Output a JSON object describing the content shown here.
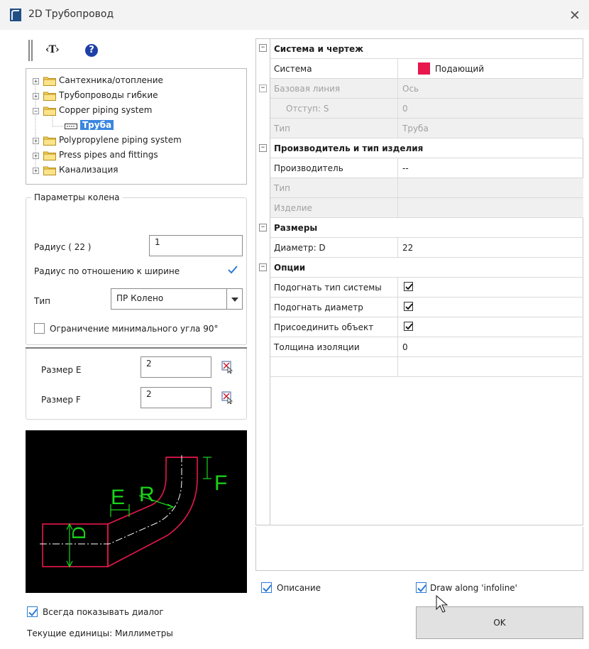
{
  "window": {
    "title": "2D Трубопровод",
    "close_label": "✕"
  },
  "toolbar": {
    "text_tool_label": "‹T›",
    "help_label": "?"
  },
  "tree": {
    "items": [
      {
        "label": "Сантехника/отопление",
        "expanded": false
      },
      {
        "label": "Трубопроводы гибкие",
        "expanded": false
      },
      {
        "label": "Copper piping system",
        "expanded": true
      },
      {
        "label": "Труба",
        "selected": true
      },
      {
        "label": "Polypropylene piping system",
        "expanded": false
      },
      {
        "label": "Press pipes and fittings",
        "expanded": false
      },
      {
        "label": "Канализация",
        "expanded": false
      }
    ]
  },
  "elbow_params": {
    "group_title": "Параметры колена",
    "radius_label": "Радиус ( 22 )",
    "radius_value": "1",
    "radius_relative_label": "Радиус по отношению к ширине",
    "radius_relative_checked": true,
    "type_label": "Тип",
    "type_value": "ПР Колено",
    "min_angle_label": "Ограничение минимального угла 90°",
    "min_angle_checked": false,
    "size_e_label": "Размер E",
    "size_e_value": "2",
    "size_f_label": "Размер F",
    "size_f_value": "2"
  },
  "preview": {
    "label_e": "E",
    "label_r": "R",
    "label_f": "F",
    "label_d": "D"
  },
  "always_show": {
    "label": "Всегда показывать диалог",
    "checked": true
  },
  "units": {
    "label": "Текущие единицы: Миллиметры"
  },
  "properties": {
    "cat_system": "Система и чертеж",
    "system_label": "Система",
    "system_value": "Подающий",
    "system_color": "#e8174c",
    "baseline_label": "Базовая линия",
    "baseline_value": "Ось",
    "offset_label": "Отступ: S",
    "offset_value": "0",
    "type_label": "Тип",
    "type_value": "Труба",
    "cat_manufacturer": "Производитель и тип изделия",
    "manufacturer_label": "Производитель",
    "manufacturer_value": "--",
    "mtype_label": "Тип",
    "product_label": "Изделие",
    "cat_sizes": "Размеры",
    "diameter_label": "Диаметр: D",
    "diameter_value": "22",
    "cat_options": "Опции",
    "fit_system_label": "Подогнать тип системы",
    "fit_diameter_label": "Подогнать диаметр",
    "attach_label": "Присоединить объект",
    "insulation_label": "Толщина изоляции",
    "insulation_value": "0"
  },
  "bottom": {
    "description_label": "Описание",
    "description_checked": true,
    "draw_along_label": "Draw along 'infoline'",
    "draw_along_checked": true,
    "ok_label": "OK"
  },
  "colors": {
    "accent": "#2e7bd6",
    "selection": "#3a86e0",
    "preview_red": "#e8174c",
    "preview_green": "#19d619"
  }
}
